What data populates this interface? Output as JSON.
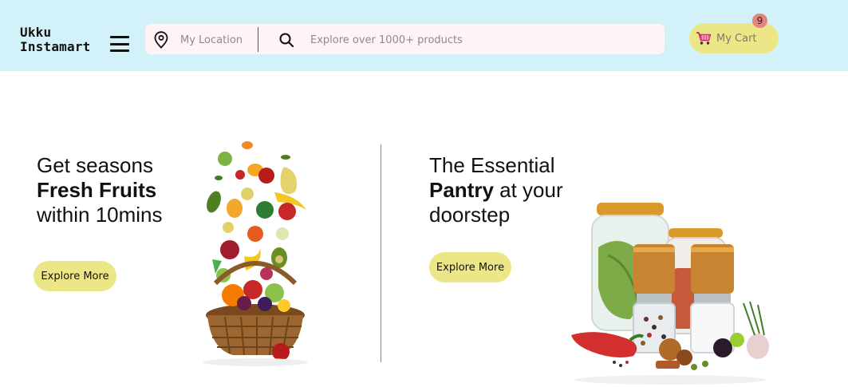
{
  "header": {
    "logo_line1": "Ukku",
    "logo_line2": "Instamart",
    "location_label": "My Location",
    "search_placeholder": "Explore over 1000+ products",
    "cart_label": "My Cart",
    "cart_count": "9"
  },
  "promos": [
    {
      "line1": "Get seasons",
      "line2_bold": "Fresh Fruits",
      "line3": "within 10mins",
      "button": "Explore More"
    },
    {
      "line1": "The Essential",
      "line2_bold": "Pantry",
      "line2_rest": " at your",
      "line3": "doorstep",
      "button": "Explore More"
    }
  ],
  "colors": {
    "header_bg": "#d3f1f8",
    "accent_yellow": "#ece786",
    "badge": "#e2867d",
    "search_bg": "#fef3f5"
  },
  "icons": [
    "hamburger-icon",
    "location-pin-icon",
    "search-icon",
    "shopping-cart-icon"
  ]
}
